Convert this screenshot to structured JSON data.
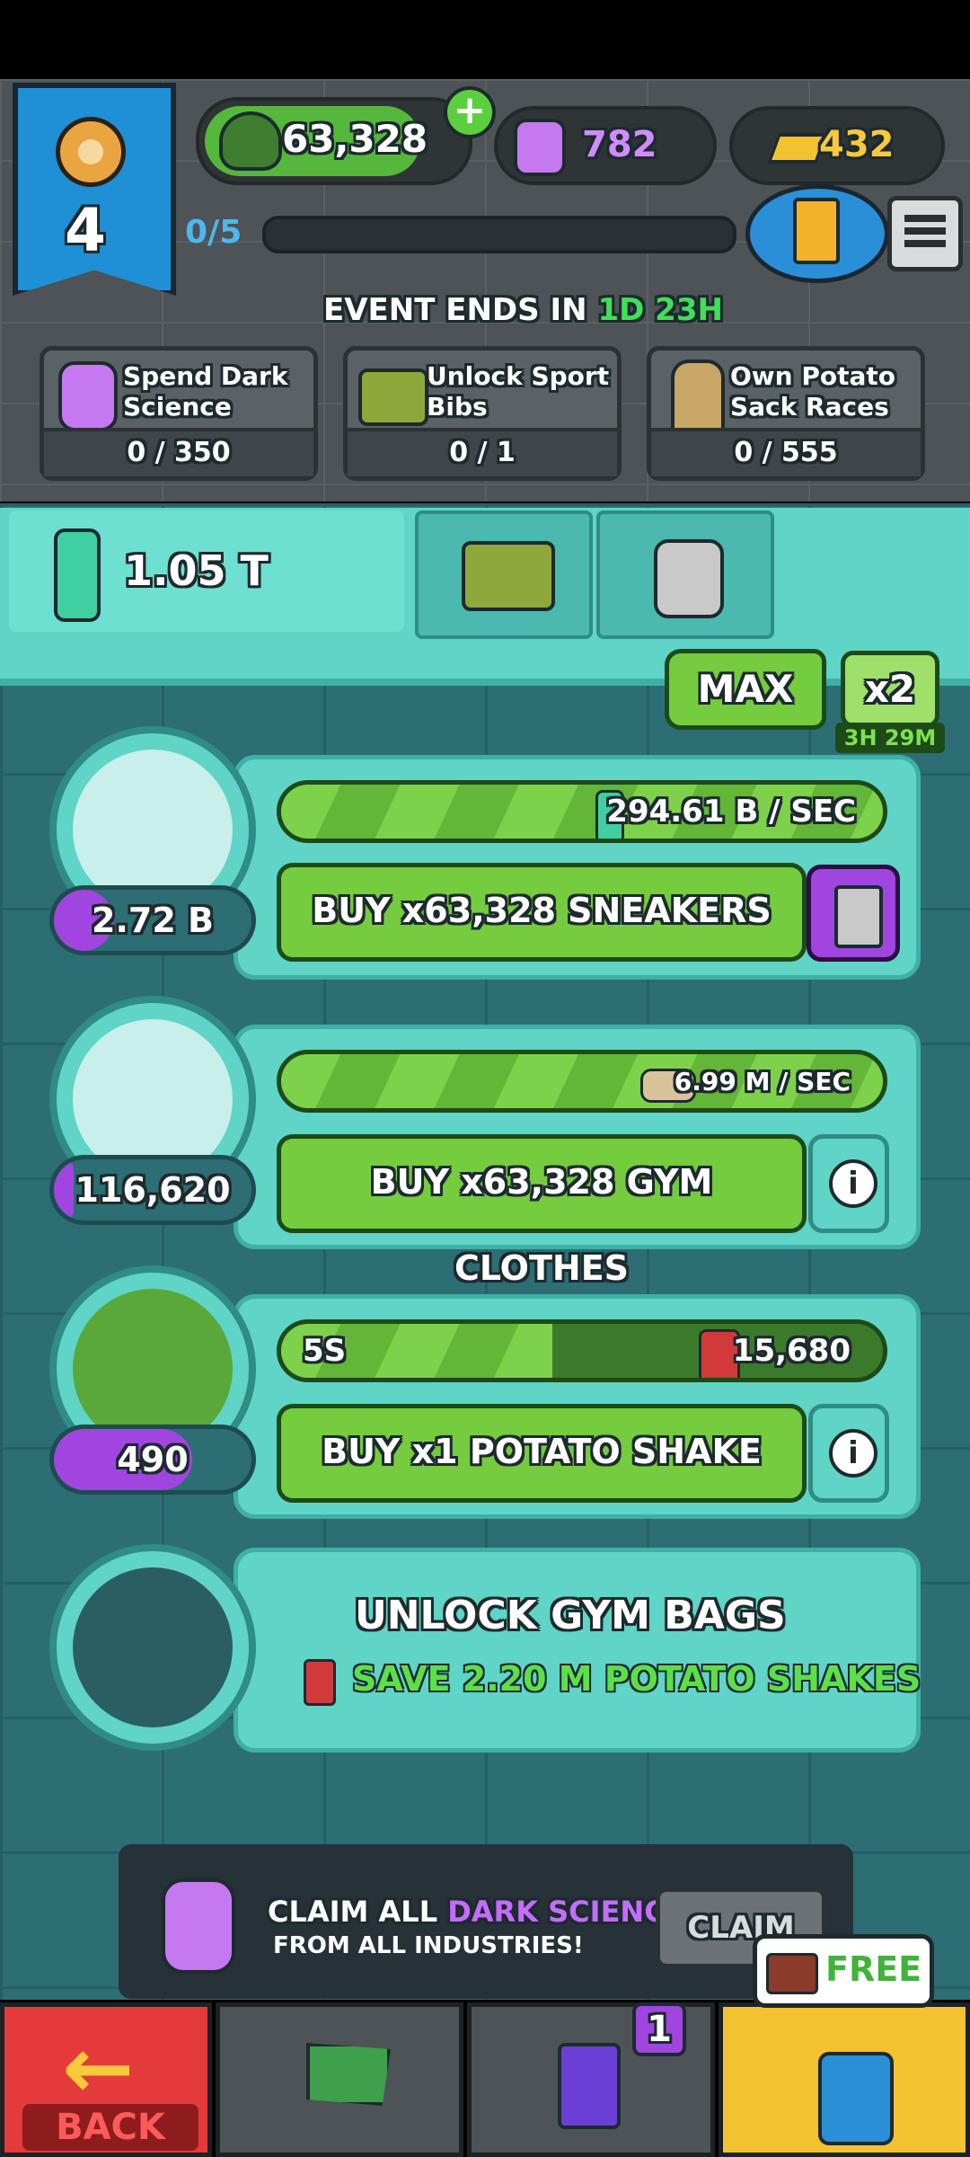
{
  "hud": {
    "level": "4",
    "helmet_currency": "63,328",
    "dark_science": "782",
    "gold": "432",
    "progress": "0/5",
    "progress_fraction": 0.0
  },
  "event": {
    "ends_label": "EVENT ENDS IN",
    "ends_days": "1D",
    "ends_hours": "23H",
    "cards": [
      {
        "label": "Spend Dark Science",
        "count": "0 / 350",
        "icon": "dark-science-jar-icon"
      },
      {
        "label": "Unlock Sport Bibs",
        "count": "0 / 1",
        "icon": "sport-bib-icon"
      },
      {
        "label": "Own Potato Sack Races",
        "count": "0 / 555",
        "icon": "potato-sack-racer-icon"
      }
    ]
  },
  "tabs": {
    "main_value": "1.05 T",
    "main_icon": "water-bottle-icon",
    "tab2_icon": "sport-bib-icon",
    "tab3_icon": "lock-icon"
  },
  "controls": {
    "max_label": "MAX",
    "boost_label": "x2",
    "boost_timer": "3H 29M"
  },
  "rows": [
    {
      "name": "sneakers",
      "icon": "sneakers-icon",
      "owned": "2.72 B",
      "owned_fill": 0.3,
      "rate_icon": "water-bottle-icon",
      "rate": "294.61 B / SEC",
      "rate_fill": 1.0,
      "buy_label": "BUY x63,328 SNEAKERS",
      "side_icon": "card-upgrade-icon"
    },
    {
      "name": "gym-clothes",
      "icon": "gym-shirt-icon",
      "owned": "116,620",
      "owned_fill": 0.1,
      "rate_icon": "sneakers-icon",
      "rate": "6.99 M / SEC",
      "rate_fill": 1.0,
      "buy_label": "BUY x63,328 GYM CLOTHES",
      "side_icon": "info-icon"
    },
    {
      "name": "potato-shake",
      "icon": "potato-shake-icon",
      "owned": "490",
      "owned_fill": 0.7,
      "timer": "5S",
      "rate_icon": "gym-shirt-icon",
      "rate": "15,680",
      "rate_fill": 0.45,
      "buy_label": "BUY x1 POTATO SHAKE",
      "side_icon": "info-icon"
    }
  ],
  "locked": {
    "title": "UNLOCK GYM BAGS",
    "subtitle": "SAVE 2.20 M POTATO SHAKES",
    "icon": "gym-bag-lock-icon"
  },
  "claim": {
    "text_prefix": "CLAIM ALL",
    "text_highlight": "DARK SCIENCE",
    "text_line2": "FROM ALL INDUSTRIES!",
    "button": "CLAIM"
  },
  "bottom_nav": {
    "back_label": "BACK",
    "cards_badge": "1",
    "free_label": "FREE"
  },
  "colors": {
    "accent_green": "#74cc3e",
    "teal": "#5fd4c7",
    "purple": "#a145e0",
    "event_green": "#3fe05a"
  }
}
